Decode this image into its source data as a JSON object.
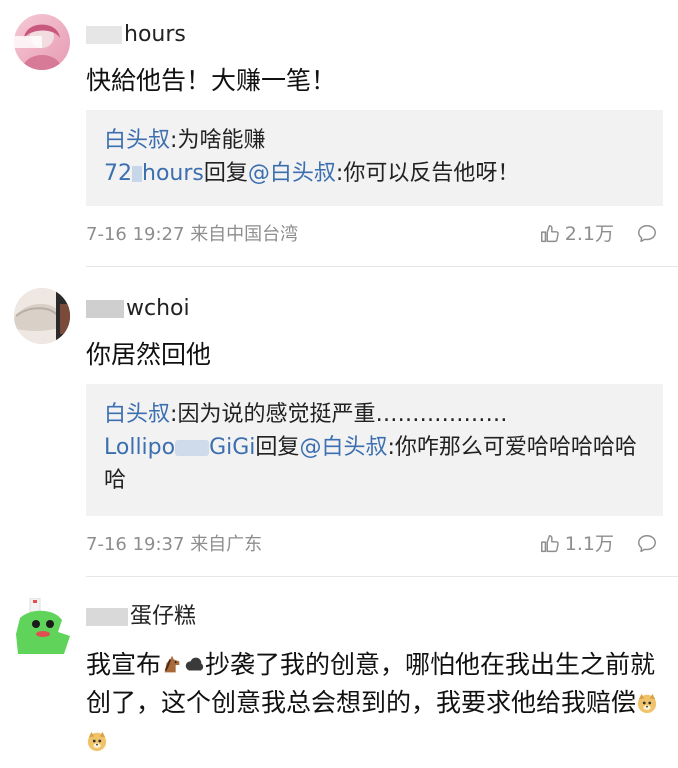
{
  "comments": [
    {
      "username_suffix": "hours",
      "text": "快給他告！大赚一笔！",
      "replies": [
        {
          "author": "白头叔",
          "sep": ":",
          "text": "为啥能赚",
          "to": "",
          "action": ""
        },
        {
          "author": "72",
          "author_suffix": "hours",
          "action": "回复",
          "to": "@白头叔",
          "sep": ":",
          "text": "你可以反告他呀！"
        }
      ],
      "time": "7-16 19:27",
      "location": "来自中国台湾",
      "likes": "2.1万"
    },
    {
      "username_suffix": "wchoi",
      "text": "你居然回他",
      "replies": [
        {
          "author": "白头叔",
          "sep": ":",
          "text": "因为说的感觉挺严重………………"
        },
        {
          "author": "Lollipo",
          "author_suffix": "GiGi",
          "action": "回复",
          "to": "@白头叔",
          "sep": ":",
          "text": "你咋那么可爱哈哈哈哈哈哈"
        }
      ],
      "time": "7-16 19:37",
      "location": "来自广东",
      "likes": "1.1万"
    },
    {
      "username_suffix": "蛋仔糕",
      "text_part1": "我宣布",
      "text_part2": "抄袭了我的创意，哪怕他在我出生之前就创了，这个创意我总会想到的，我要求他给我赔偿"
    }
  ],
  "icons": {
    "like": "thumbs-up-icon",
    "comment": "comment-bubble-icon"
  },
  "colors": {
    "link": "#3c6fb0",
    "meta": "#8e8e8e",
    "reply_bg": "#f2f2f2"
  }
}
